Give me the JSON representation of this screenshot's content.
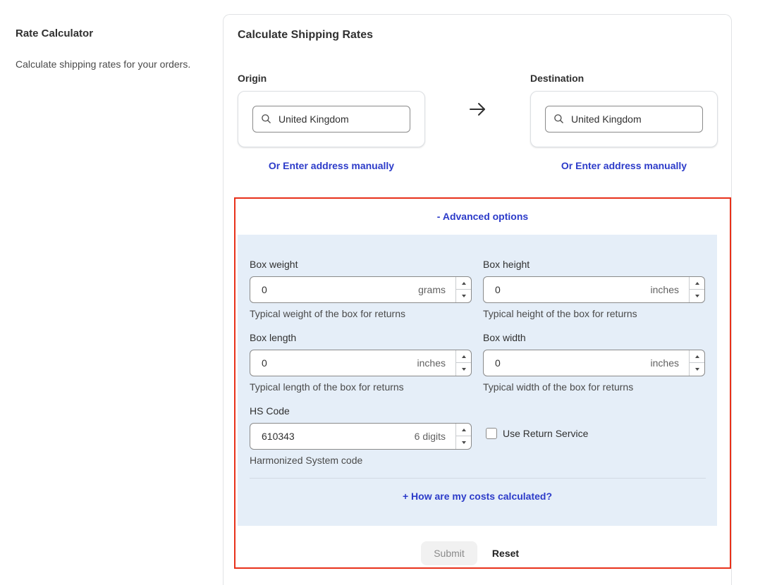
{
  "sidebar": {
    "title": "Rate Calculator",
    "description": "Calculate shipping rates for your orders."
  },
  "card": {
    "title": "Calculate Shipping Rates"
  },
  "origin": {
    "label": "Origin",
    "value": "United Kingdom",
    "manual_link": "Or Enter address manually"
  },
  "destination": {
    "label": "Destination",
    "value": "United Kingdom",
    "manual_link": "Or Enter address manually"
  },
  "advanced": {
    "toggle_label": "- Advanced options",
    "box_weight": {
      "label": "Box weight",
      "value": "0",
      "suffix": "grams",
      "help": "Typical weight of the box for returns"
    },
    "box_height": {
      "label": "Box height",
      "value": "0",
      "suffix": "inches",
      "help": "Typical height of the box for returns"
    },
    "box_length": {
      "label": "Box length",
      "value": "0",
      "suffix": "inches",
      "help": "Typical length of the box for returns"
    },
    "box_width": {
      "label": "Box width",
      "value": "0",
      "suffix": "inches",
      "help": "Typical width of the box for returns"
    },
    "hs_code": {
      "label": "HS Code",
      "value": "610343",
      "suffix": "6 digits",
      "help": "Harmonized System code"
    },
    "return_service": {
      "label": "Use Return Service",
      "checked": false
    },
    "costs_link": "+ How are my costs calculated?"
  },
  "actions": {
    "submit_label": "Submit",
    "reset_label": "Reset"
  },
  "colors": {
    "link": "#2c3bc9",
    "panel_bg": "#e5eef8",
    "highlight_border": "#e8311a"
  }
}
